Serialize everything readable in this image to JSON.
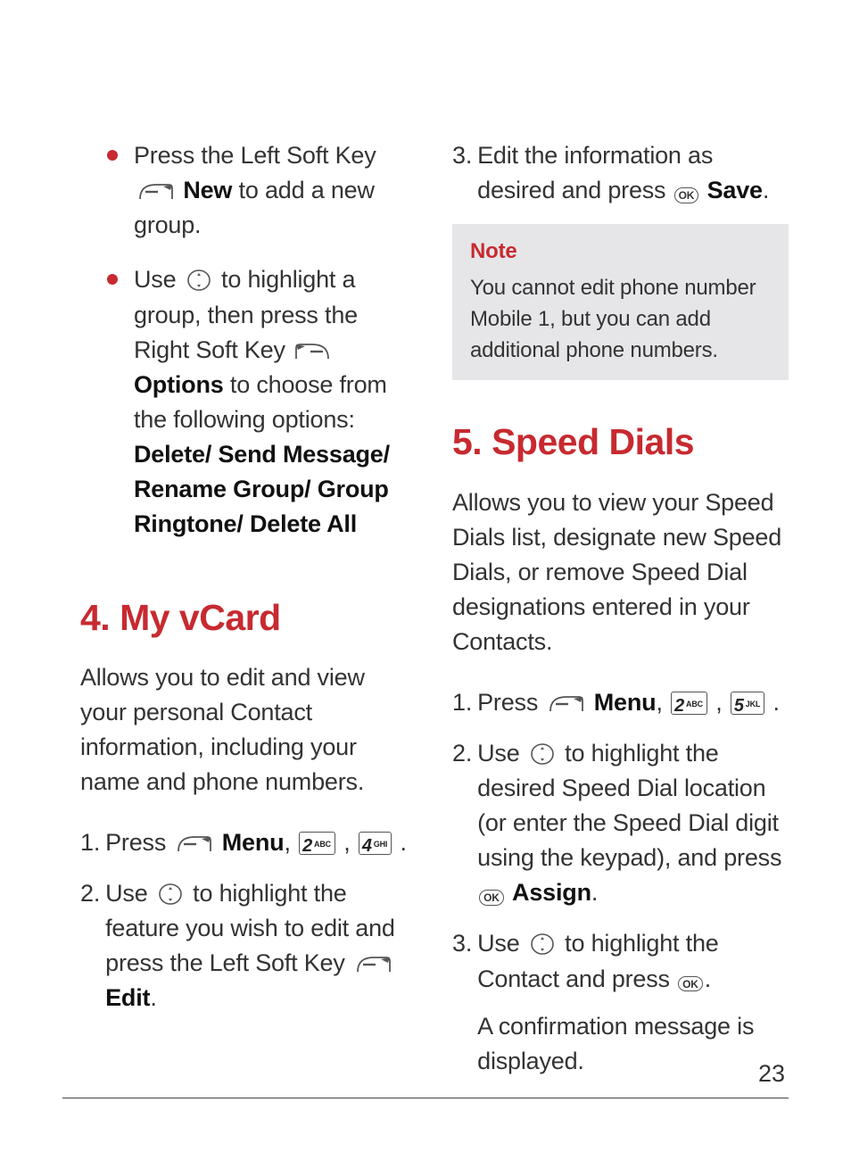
{
  "left": {
    "bullets": [
      {
        "pre": "Press the Left Soft Key ",
        "bold1": "New",
        "post1": " to add a new group."
      },
      {
        "pre": "Use ",
        "mid1": " to highlight a group, then press the Right Soft Key ",
        "bold1": "Options",
        "post1": " to choose from the following options: ",
        "bold2": "Delete/ Send Message/ Rename Group/ Group Ringtone/ Delete All"
      }
    ],
    "heading": "4. My vCard",
    "intro": "Allows you to edit and view your personal Contact information, including your name and phone numbers.",
    "steps": [
      {
        "n": "1.",
        "t1": "Press ",
        "bold1": "Menu",
        "t2": ", ",
        "t3": " , ",
        "t4": " ."
      },
      {
        "n": "2.",
        "t1": "Use ",
        "t2": " to highlight the feature you wish to edit and press the Left Soft Key ",
        "bold1": "Edit",
        "t3": "."
      }
    ]
  },
  "right": {
    "step3": {
      "n": "3.",
      "t1": "Edit the information as desired and press ",
      "bold1": "Save",
      "t2": "."
    },
    "note": {
      "title": "Note",
      "body": "You cannot edit phone number Mobile 1, but you can add additional phone numbers."
    },
    "heading": "5. Speed Dials",
    "intro": "Allows you to view your Speed Dials list, designate new Speed Dials, or remove Speed Dial designations entered in your Contacts.",
    "steps": [
      {
        "n": "1.",
        "t1": "Press ",
        "bold1": "Menu",
        "t2": ", ",
        "t3": ", ",
        "t4": " ."
      },
      {
        "n": "2.",
        "t1": "Use ",
        "t2": " to highlight the desired Speed Dial location (or enter the Speed Dial digit using the keypad), and press ",
        "bold1": "Assign",
        "t3": "."
      },
      {
        "n": "3.",
        "t1": "Use ",
        "t2": " to highlight the Contact and press ",
        "t3": ".",
        "para2": "A confirmation message is displayed."
      }
    ]
  },
  "keys": {
    "k2_big": "2",
    "k2_sub": "ABC",
    "k4_big": "4",
    "k4_sub": "GHI",
    "k5_big": "5",
    "k5_sub": "JKL",
    "ok": "OK"
  },
  "pageNumber": "23"
}
